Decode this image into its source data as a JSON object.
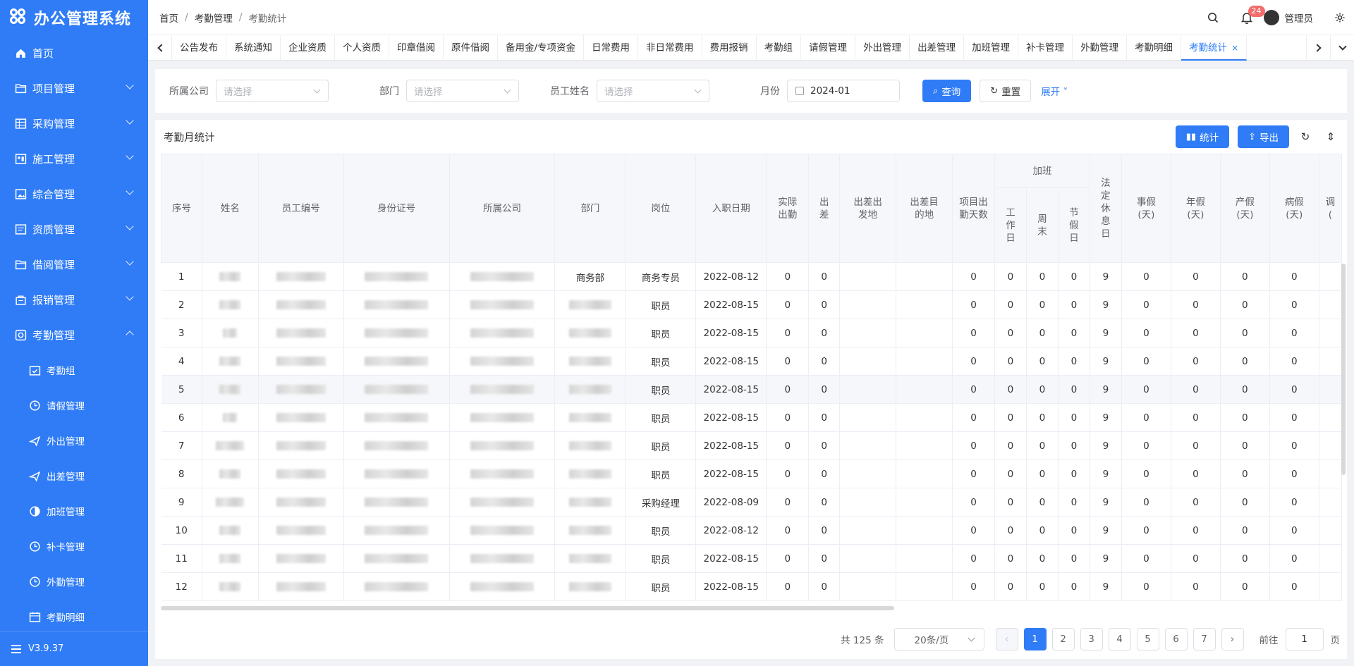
{
  "app": {
    "title": "办公管理系统",
    "version": "V3.9.37"
  },
  "sidebar": {
    "items": [
      {
        "label": "首页",
        "icon": "home-icon"
      },
      {
        "label": "项目管理",
        "icon": "folder-icon"
      },
      {
        "label": "采购管理",
        "icon": "grid-icon"
      },
      {
        "label": "施工管理",
        "icon": "dashboard-icon"
      },
      {
        "label": "综合管理",
        "icon": "image-icon"
      },
      {
        "label": "资质管理",
        "icon": "chart-icon"
      },
      {
        "label": "借阅管理",
        "icon": "folder-icon"
      },
      {
        "label": "报销管理",
        "icon": "wallet-icon"
      },
      {
        "label": "考勤管理",
        "icon": "target-icon"
      }
    ],
    "sub_items": [
      {
        "label": "考勤组",
        "icon": "calendar-check-icon"
      },
      {
        "label": "请假管理",
        "icon": "clock-icon"
      },
      {
        "label": "外出管理",
        "icon": "plane-icon"
      },
      {
        "label": "出差管理",
        "icon": "plane-icon"
      },
      {
        "label": "加班管理",
        "icon": "clock-half-icon"
      },
      {
        "label": "补卡管理",
        "icon": "clock-icon"
      },
      {
        "label": "外勤管理",
        "icon": "clock-icon"
      },
      {
        "label": "考勤明细",
        "icon": "calendar-icon"
      }
    ]
  },
  "header": {
    "breadcrumb": [
      "首页",
      "考勤管理",
      "考勤统计"
    ],
    "notification_count": "24",
    "user_name": "管理员"
  },
  "tabs": [
    "公告发布",
    "系统通知",
    "企业资质",
    "个人资质",
    "印章借阅",
    "原件借阅",
    "备用金/专项资金",
    "日常费用",
    "非日常费用",
    "费用报销",
    "考勤组",
    "请假管理",
    "外出管理",
    "出差管理",
    "加班管理",
    "补卡管理",
    "外勤管理",
    "考勤明细",
    "考勤统计"
  ],
  "active_tab": "考勤统计",
  "filter": {
    "company_label": "所属公司",
    "company_placeholder": "请选择",
    "dept_label": "部门",
    "dept_placeholder": "请选择",
    "name_label": "员工姓名",
    "name_placeholder": "请选择",
    "month_label": "月份",
    "month_value": "2024-01",
    "search_btn": "查询",
    "reset_btn": "重置",
    "expand_link": "展开"
  },
  "card": {
    "title": "考勤月统计",
    "stat_btn": "统计",
    "export_btn": "导出"
  },
  "table": {
    "headers": {
      "seq": "序号",
      "name": "姓名",
      "emp_no": "员工编号",
      "id_no": "身份证号",
      "company": "所属公司",
      "dept": "部门",
      "post": "岗位",
      "hire_date": "入职日期",
      "actual": "实际出勤",
      "trip": "出差",
      "trip_from": "出差出发地",
      "trip_to": "出差目的地",
      "proj_days": "项目出勤天数",
      "overtime": "加班",
      "ot_work": "工作日",
      "ot_weekend": "周末",
      "ot_holiday": "节假日",
      "legal_rest": "法定休息日",
      "personal_leave": "事假(天)",
      "annual_leave": "年假(天)",
      "maternity_leave": "产假(天)",
      "sick_leave": "病假(天)",
      "more": "调("
    },
    "rows": [
      {
        "seq": "1",
        "dept": "商务部",
        "post": "商务专员",
        "hire": "2022-08-12",
        "actual": "0",
        "trip": "0",
        "proj": "0",
        "ot1": "0",
        "ot2": "0",
        "ot3": "0",
        "legal": "9",
        "l1": "0",
        "l2": "0",
        "l3": "0",
        "l4": "0"
      },
      {
        "seq": "2",
        "dept": "",
        "post": "职员",
        "hire": "2022-08-15",
        "actual": "0",
        "trip": "0",
        "proj": "0",
        "ot1": "0",
        "ot2": "0",
        "ot3": "0",
        "legal": "9",
        "l1": "0",
        "l2": "0",
        "l3": "0",
        "l4": "0"
      },
      {
        "seq": "3",
        "dept": "",
        "post": "职员",
        "hire": "2022-08-15",
        "actual": "0",
        "trip": "0",
        "proj": "0",
        "ot1": "0",
        "ot2": "0",
        "ot3": "0",
        "legal": "9",
        "l1": "0",
        "l2": "0",
        "l3": "0",
        "l4": "0"
      },
      {
        "seq": "4",
        "dept": "",
        "post": "职员",
        "hire": "2022-08-15",
        "actual": "0",
        "trip": "0",
        "proj": "0",
        "ot1": "0",
        "ot2": "0",
        "ot3": "0",
        "legal": "9",
        "l1": "0",
        "l2": "0",
        "l3": "0",
        "l4": "0"
      },
      {
        "seq": "5",
        "dept": "",
        "post": "职员",
        "hire": "2022-08-15",
        "actual": "0",
        "trip": "0",
        "proj": "0",
        "ot1": "0",
        "ot2": "0",
        "ot3": "0",
        "legal": "9",
        "l1": "0",
        "l2": "0",
        "l3": "0",
        "l4": "0"
      },
      {
        "seq": "6",
        "dept": "",
        "post": "职员",
        "hire": "2022-08-15",
        "actual": "0",
        "trip": "0",
        "proj": "0",
        "ot1": "0",
        "ot2": "0",
        "ot3": "0",
        "legal": "9",
        "l1": "0",
        "l2": "0",
        "l3": "0",
        "l4": "0"
      },
      {
        "seq": "7",
        "dept": "",
        "post": "职员",
        "hire": "2022-08-15",
        "actual": "0",
        "trip": "0",
        "proj": "0",
        "ot1": "0",
        "ot2": "0",
        "ot3": "0",
        "legal": "9",
        "l1": "0",
        "l2": "0",
        "l3": "0",
        "l4": "0"
      },
      {
        "seq": "8",
        "dept": "",
        "post": "职员",
        "hire": "2022-08-15",
        "actual": "0",
        "trip": "0",
        "proj": "0",
        "ot1": "0",
        "ot2": "0",
        "ot3": "0",
        "legal": "9",
        "l1": "0",
        "l2": "0",
        "l3": "0",
        "l4": "0"
      },
      {
        "seq": "9",
        "dept": "",
        "post": "采购经理",
        "hire": "2022-08-09",
        "actual": "0",
        "trip": "0",
        "proj": "0",
        "ot1": "0",
        "ot2": "0",
        "ot3": "0",
        "legal": "9",
        "l1": "0",
        "l2": "0",
        "l3": "0",
        "l4": "0"
      },
      {
        "seq": "10",
        "dept": "",
        "post": "职员",
        "hire": "2022-08-12",
        "actual": "0",
        "trip": "0",
        "proj": "0",
        "ot1": "0",
        "ot2": "0",
        "ot3": "0",
        "legal": "9",
        "l1": "0",
        "l2": "0",
        "l3": "0",
        "l4": "0"
      },
      {
        "seq": "11",
        "dept": "",
        "post": "职员",
        "hire": "2022-08-15",
        "actual": "0",
        "trip": "0",
        "proj": "0",
        "ot1": "0",
        "ot2": "0",
        "ot3": "0",
        "legal": "9",
        "l1": "0",
        "l2": "0",
        "l3": "0",
        "l4": "0"
      },
      {
        "seq": "12",
        "dept": "",
        "post": "职员",
        "hire": "2022-08-15",
        "actual": "0",
        "trip": "0",
        "proj": "0",
        "ot1": "0",
        "ot2": "0",
        "ot3": "0",
        "legal": "9",
        "l1": "0",
        "l2": "0",
        "l3": "0",
        "l4": "0"
      }
    ]
  },
  "pagination": {
    "total": "共 125 条",
    "page_size": "20条/页",
    "pages": [
      "1",
      "2",
      "3",
      "4",
      "5",
      "6",
      "7"
    ],
    "current": "1",
    "goto_label": "前往",
    "goto_value": "1",
    "page_unit": "页"
  },
  "colors": {
    "primary": "#2f7cf6",
    "badge": "#f56c6c"
  }
}
